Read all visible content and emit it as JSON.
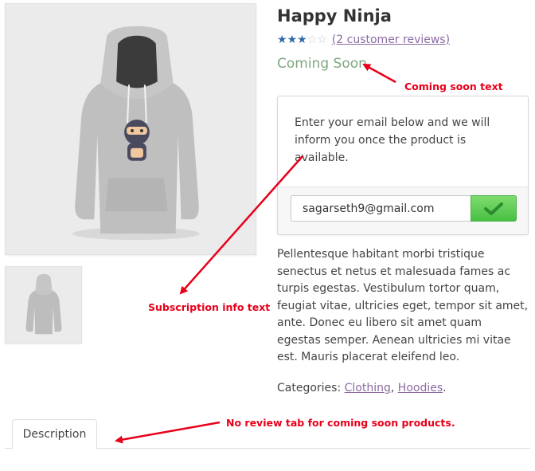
{
  "product": {
    "title": "Happy Ninja",
    "rating_value": 3,
    "rating_max": 5,
    "reviews_link": "(2 customer reviews)",
    "status": "Coming Soon"
  },
  "subscription": {
    "info_text": "Enter your email below and we will inform you once the product is available.",
    "email_value": "sagarseth9@gmail.com",
    "submit_icon": "checkmark-icon"
  },
  "description_text": "Pellentesque habitant morbi tristique senectus et netus et malesuada fames ac turpis egestas. Vestibulum tortor quam, feugiat vitae, ultricies eget, tempor sit amet, ante. Donec eu libero sit amet quam egestas semper. Aenean ultricies mi vitae est. Mauris placerat eleifend leo.",
  "categories": {
    "label": "Categories:",
    "items": [
      "Clothing",
      "Hoodies"
    ],
    "separator": ",",
    "end": "."
  },
  "tabs": [
    {
      "label": "Description"
    }
  ],
  "annotations": {
    "coming_soon": "Coming soon text",
    "subscription": "Subscription info text",
    "no_review": "No review tab for coming soon products."
  },
  "colors": {
    "link": "#8b6ba2",
    "status": "#7fa77f",
    "star_on": "#2f6aa8",
    "annotation": "#e8001a",
    "button": "#47c043"
  }
}
